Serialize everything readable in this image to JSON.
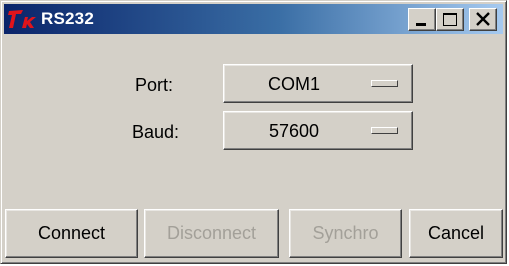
{
  "window": {
    "title": "RS232",
    "icon": "tk-feather-icon",
    "controls": {
      "minimize": "minimize-icon",
      "maximize": "maximize-icon",
      "close": "close-icon"
    }
  },
  "form": {
    "port": {
      "label": "Port:",
      "value": "COM1"
    },
    "baud": {
      "label": "Baud:",
      "value": "57600"
    }
  },
  "buttons": {
    "connect": "Connect",
    "disconnect": "Disconnect",
    "synchro": "Synchro",
    "cancel": "Cancel"
  },
  "state": {
    "disconnect_enabled": false,
    "synchro_enabled": false
  },
  "colors": {
    "titlebar_start": "#0a246a",
    "titlebar_end": "#a6caf0",
    "face": "#d4d0c8",
    "disabled_text": "#a3a099",
    "icon_red": "#e0141b"
  }
}
